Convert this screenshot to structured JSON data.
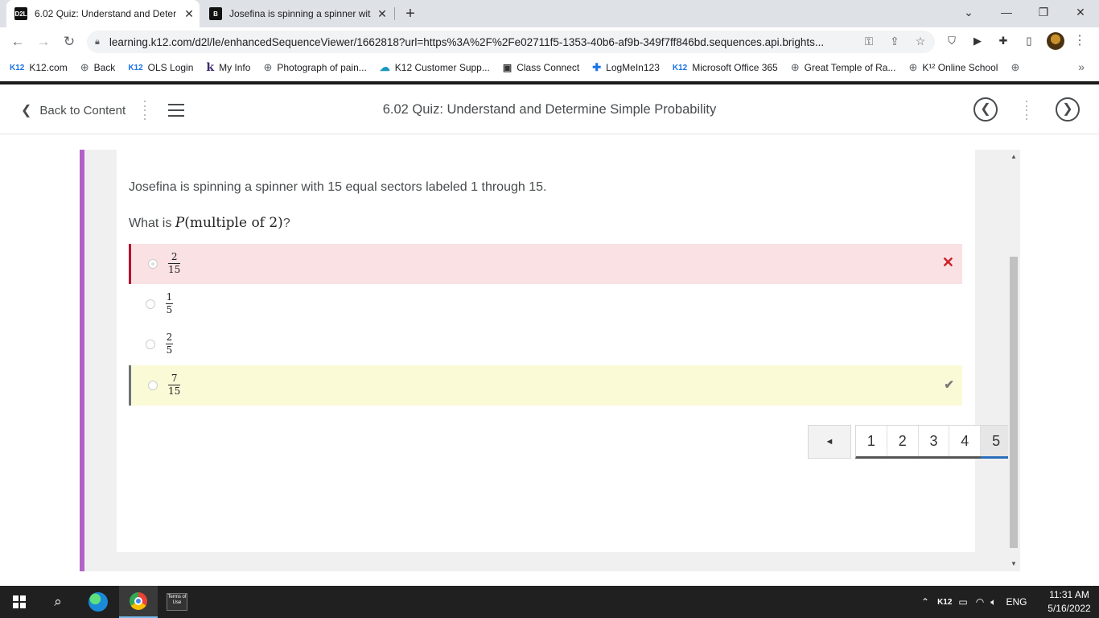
{
  "browser": {
    "tabs": [
      {
        "favicon": "D2L",
        "title": "6.02 Quiz: Understand and Deter",
        "active": true
      },
      {
        "favicon": "B",
        "title": "Josefina is spinning a spinner wit",
        "active": false
      }
    ],
    "url": "learning.k12.com/d2l/le/enhancedSequenceViewer/1662818?url=https%3A%2F%2Fe02711f5-1353-40b6-af9b-349f7ff846bd.sequences.api.brights...",
    "bookmarks": [
      {
        "icon": "K12",
        "label": "K12.com"
      },
      {
        "icon": "globe-icon",
        "label": "Back"
      },
      {
        "icon": "K12",
        "label": "OLS Login"
      },
      {
        "icon": "k12",
        "label": "My Info"
      },
      {
        "icon": "globe-icon",
        "label": "Photograph of pain..."
      },
      {
        "icon": "salesforce-icon",
        "label": "K12 Customer Supp..."
      },
      {
        "icon": "video-icon",
        "label": "Class Connect"
      },
      {
        "icon": "logmein-icon",
        "label": "LogMeIn123"
      },
      {
        "icon": "K12",
        "label": "Microsoft Office 365"
      },
      {
        "icon": "globe-icon",
        "label": "Great Temple of Ra..."
      },
      {
        "icon": "globe-icon",
        "label": "K¹² Online School"
      }
    ]
  },
  "header": {
    "back_label": "Back to Content",
    "title": "6.02 Quiz: Understand and Determine Simple Probability"
  },
  "question": {
    "text": "Josefina is spinning a spinner with 15 equal sectors labeled 1 through 15.",
    "prompt_prefix": "What is ",
    "prompt_P": "P",
    "prompt_math": "(multiple of 2)",
    "prompt_suffix": "?",
    "options": [
      {
        "num": "2",
        "den": "15",
        "status": "incorrect",
        "selected": true
      },
      {
        "num": "1",
        "den": "5",
        "status": "none",
        "selected": false
      },
      {
        "num": "2",
        "den": "5",
        "status": "none",
        "selected": false
      },
      {
        "num": "7",
        "den": "15",
        "status": "correct",
        "selected": false
      }
    ]
  },
  "pager": {
    "prev": "◄",
    "pages": [
      "1",
      "2",
      "3",
      "4",
      "5"
    ],
    "current": "5"
  },
  "taskbar": {
    "terms_label": "Terms of Use",
    "tray_k12": "K12",
    "language": "ENG",
    "time": "11:31 AM",
    "date": "5/16/2022"
  },
  "colors": {
    "accent": "#b363c7",
    "incorrect_bg": "#fae1e3",
    "incorrect_mark": "#cd2026",
    "correct_bg": "#fafad6",
    "pager_current": "#2a6ebb"
  }
}
